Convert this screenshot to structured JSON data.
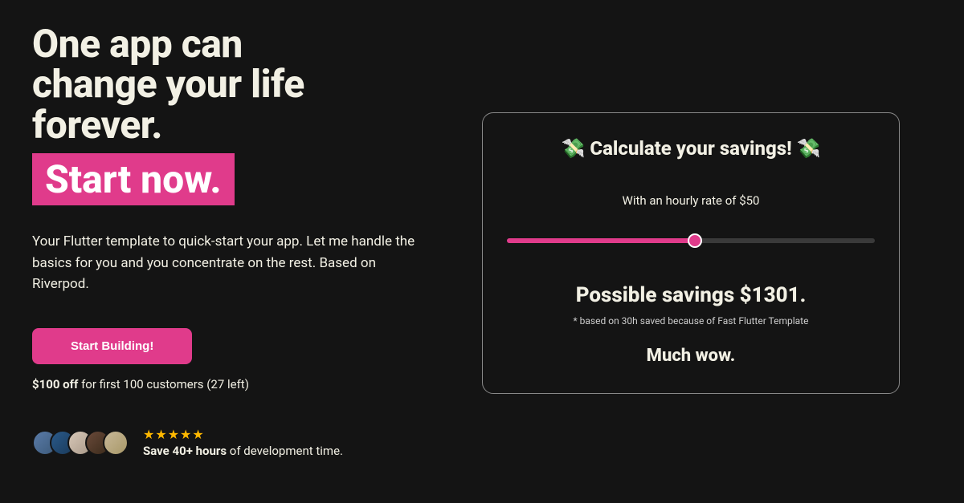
{
  "hero": {
    "headline_line1": "One app can",
    "headline_line2": "change your life",
    "headline_line3": "forever.",
    "highlight": "Start now.",
    "description": "Your Flutter template to quick-start your app. Let me handle the basics for you and you concentrate on the rest. Based on Riverpod.",
    "cta_label": "Start Building!",
    "promo_bold": "$100 off",
    "promo_rest": " for first 100 customers (27 left)"
  },
  "social": {
    "stars": "★★★★★",
    "bold": "Save 40+ hours",
    "rest": " of development time."
  },
  "calculator": {
    "title": "💸 Calculate your savings! 💸",
    "rate_prefix": "With an hourly rate of ",
    "rate_value": "$50",
    "slider_percent": 51,
    "savings_prefix": "Possible savings ",
    "savings_value": "$1301.",
    "footnote": "* based on 30h saved because of Fast Flutter Template",
    "wow": "Much wow."
  },
  "colors": {
    "accent": "#e03b8b",
    "bg": "#141414",
    "text": "#f2f0e4"
  }
}
